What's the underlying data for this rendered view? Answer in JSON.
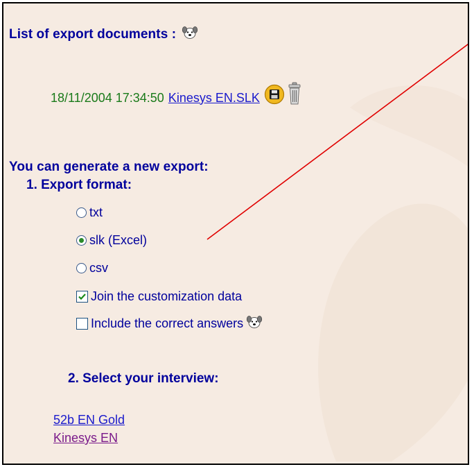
{
  "export_list": {
    "heading": "List of export documents :",
    "info_icon": "dog-face-icon",
    "document": {
      "timestamp": "18/11/2004 17:34:50",
      "filename": "Kinesys EN.SLK",
      "save_icon": "floppy-disk-icon",
      "delete_icon": "trash-can-icon"
    }
  },
  "new_export": {
    "heading": "You can generate a new export:",
    "format_heading": "1. Export format:",
    "formats": [
      {
        "label": "txt",
        "selected": false
      },
      {
        "label": "slk (Excel)",
        "selected": true
      },
      {
        "label": "csv",
        "selected": false
      }
    ],
    "options": [
      {
        "label": "Join the customization data",
        "checked": true
      },
      {
        "label": "Include the correct answers",
        "checked": false
      }
    ],
    "interview_heading": "2. Select your interview:",
    "interviews": [
      "52b EN Gold",
      "Kinesys EN"
    ]
  },
  "colors": {
    "heading": "#00009c",
    "timestamp": "#1a7a1a",
    "link": "#1a1acc",
    "visited_link": "#7a1a8a",
    "annotation_line": "#e00000",
    "background": "#f6ebe2"
  }
}
